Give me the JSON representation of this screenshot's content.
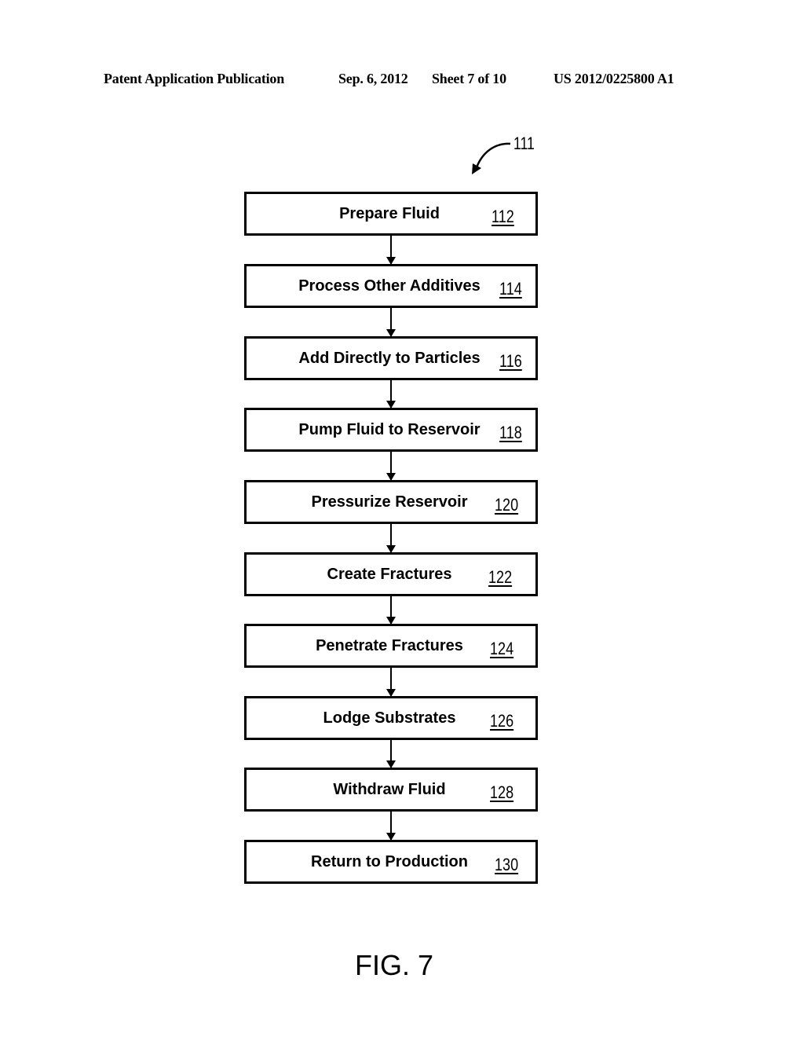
{
  "header": {
    "publication": "Patent Application Publication",
    "date": "Sep. 6, 2012",
    "sheet": "Sheet 7 of 10",
    "number": "US 2012/0225800 A1"
  },
  "diagram_ref": "111",
  "steps": [
    {
      "label": "Prepare Fluid",
      "ref": "112"
    },
    {
      "label": "Process Other Additives",
      "ref": "114"
    },
    {
      "label": "Add Directly to Particles",
      "ref": "116"
    },
    {
      "label": "Pump Fluid to Reservoir",
      "ref": "118"
    },
    {
      "label": "Pressurize Reservoir",
      "ref": "120"
    },
    {
      "label": "Create Fractures",
      "ref": "122"
    },
    {
      "label": "Penetrate Fractures",
      "ref": "124"
    },
    {
      "label": "Lodge Substrates",
      "ref": "126"
    },
    {
      "label": "Withdraw Fluid",
      "ref": "128"
    },
    {
      "label": "Return to Production",
      "ref": "130"
    }
  ],
  "caption": "FIG. 7"
}
